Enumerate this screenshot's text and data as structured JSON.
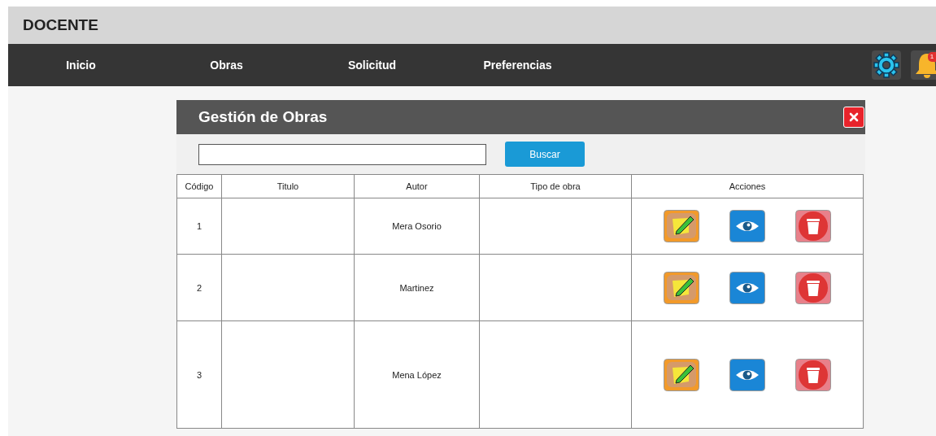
{
  "header": {
    "title": "DOCENTE"
  },
  "nav": [
    {
      "label": "Inicio"
    },
    {
      "label": "Obras"
    },
    {
      "label": "Solicitud"
    },
    {
      "label": "Preferencias"
    }
  ],
  "notifications": {
    "badge": "1"
  },
  "panel": {
    "title": "Gestión de Obras",
    "search_button": "Buscar"
  },
  "table": {
    "columns": [
      "Código",
      "Titulo",
      "Autor",
      "Tipo de obra",
      "Acciones"
    ],
    "rows": [
      {
        "code": "1",
        "author": "Mera Osorio"
      },
      {
        "code": "2",
        "author": "Martinez"
      },
      {
        "code": "3",
        "author": "Mena López"
      }
    ]
  }
}
